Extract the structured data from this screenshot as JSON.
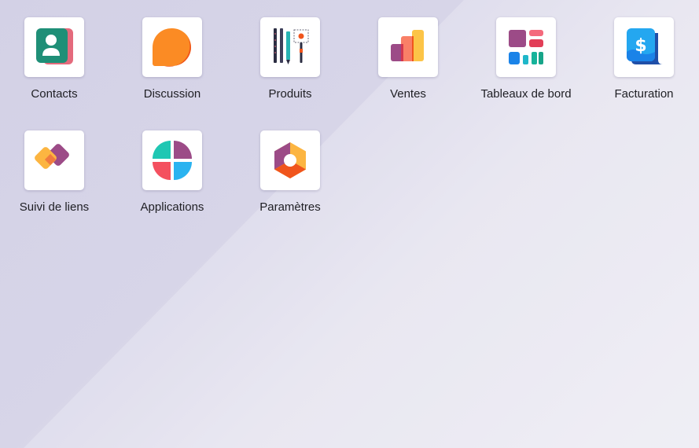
{
  "apps": [
    {
      "label": "Contacts",
      "icon": "contacts-icon"
    },
    {
      "label": "Discussion",
      "icon": "discussion-icon"
    },
    {
      "label": "Produits",
      "icon": "products-icon"
    },
    {
      "label": "Ventes",
      "icon": "sales-icon"
    },
    {
      "label": "Tableaux de bord",
      "icon": "dashboard-icon"
    },
    {
      "label": "Facturation",
      "icon": "invoicing-icon"
    },
    {
      "label": "Suivi de liens",
      "icon": "link-tracker-icon"
    },
    {
      "label": "Applications",
      "icon": "apps-icon"
    },
    {
      "label": "Paramètres",
      "icon": "settings-icon"
    }
  ],
  "colors": {
    "background_start": "#d3d1e6",
    "background_end": "#ebeaf2",
    "tile_background": "#ffffff",
    "label_text": "#1f1f24"
  }
}
